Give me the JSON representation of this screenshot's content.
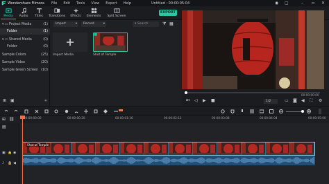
{
  "app": {
    "title": "Wondershare Filmora",
    "document": "Untitled : 00:00:05:04"
  },
  "menu": [
    "File",
    "Edit",
    "Tools",
    "View",
    "Export",
    "Help"
  ],
  "toolbar": [
    {
      "label": "Media",
      "icon": "media-icon"
    },
    {
      "label": "Audio",
      "icon": "audio-icon"
    },
    {
      "label": "Titles",
      "icon": "titles-icon"
    },
    {
      "label": "Transitions",
      "icon": "transitions-icon"
    },
    {
      "label": "Effects",
      "icon": "effects-icon"
    },
    {
      "label": "Elements",
      "icon": "elements-icon"
    },
    {
      "label": "Split Screen",
      "icon": "split-screen-icon"
    }
  ],
  "export_label": "EXPORT",
  "left_panel": [
    {
      "label": "Project Media",
      "count": "(1)"
    },
    {
      "label": "Folder",
      "count": "(1)"
    },
    {
      "label": "Shared Media",
      "count": "(0)"
    },
    {
      "label": "Folder",
      "count": "(0)"
    },
    {
      "label": "Sample Colors",
      "count": "(25)"
    },
    {
      "label": "Sample Video",
      "count": "(20)"
    },
    {
      "label": "Sample Green Screen",
      "count": "(10)"
    }
  ],
  "media": {
    "import_dd": "Import",
    "record_dd": "Record",
    "search_placeholder": "Search",
    "import_tile_label": "Import Media",
    "clip_tile_label": "Shot of Temple"
  },
  "preview": {
    "timecode": "00:00:00:00",
    "ratio": "1/2"
  },
  "ruler": [
    "00:00:00:00",
    "00:00:00:20",
    "00:00:01:16",
    "00:00:02:12",
    "00:00:03:08",
    "00:00:04:04",
    "00:00:05:00"
  ],
  "clip_label": "Shot of Temple",
  "colors": {
    "accent": "#2ac7a5",
    "clip": "#2c6d8a",
    "audio": "#234e74",
    "playhead": "#ff6b3d"
  }
}
